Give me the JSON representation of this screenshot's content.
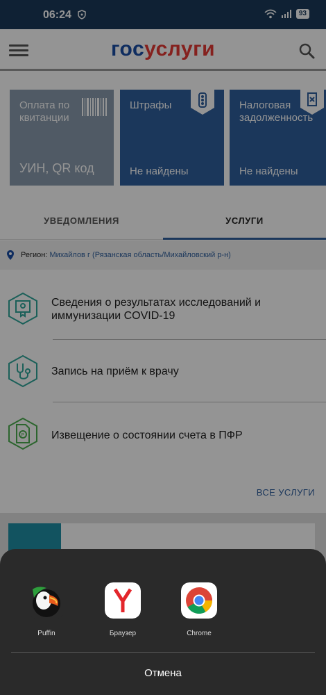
{
  "status": {
    "time": "06:24",
    "battery": "93"
  },
  "header": {
    "logo_part1": "гос",
    "logo_part2": "услуги"
  },
  "cards": [
    {
      "title": "Оплата по квитанции",
      "subtitle": "УИН, QR код"
    },
    {
      "title": "Штрафы",
      "subtitle": "Не найдены"
    },
    {
      "title": "Налоговая задолженность",
      "subtitle": "Не найдены"
    }
  ],
  "tabs": [
    {
      "label": "УВЕДОМЛЕНИЯ"
    },
    {
      "label": "УСЛУГИ"
    }
  ],
  "region": {
    "label": "Регион:",
    "value": "Михайлов г (Рязанская область/Михайловский р-н)"
  },
  "services": [
    {
      "label": "Сведения о результатах исследований и иммунизации COVID-19",
      "icon": "certificate-icon"
    },
    {
      "label": "Запись на приём к врачу",
      "icon": "stethoscope-icon"
    },
    {
      "label": "Извещение о состоянии счета в ПФР",
      "icon": "pension-document-icon"
    }
  ],
  "all_services_label": "ВСЕ УСЛУГИ",
  "share_sheet": {
    "apps": [
      {
        "label": "Puffin",
        "icon": "puffin-icon"
      },
      {
        "label": "Браузер",
        "icon": "yandex-browser-icon"
      },
      {
        "label": "Chrome",
        "icon": "chrome-icon"
      }
    ],
    "cancel_label": "Отмена"
  },
  "colors": {
    "primary": "#2f5f9e",
    "accent": "#e53935",
    "service_icon": "#2fa59a"
  }
}
